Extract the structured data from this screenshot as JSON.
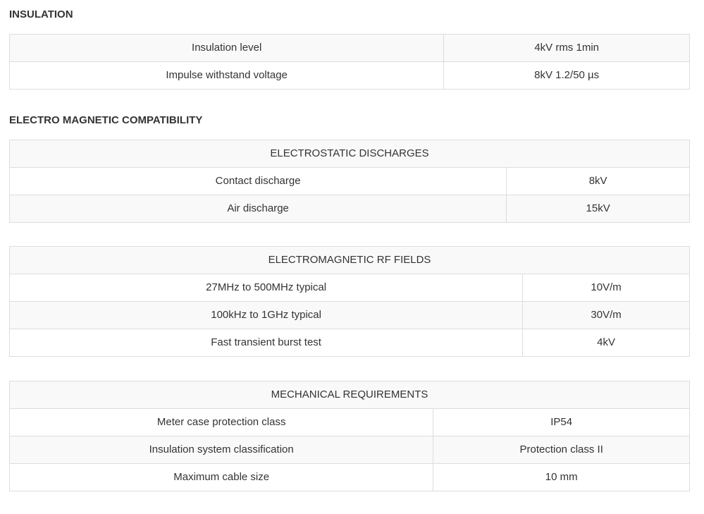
{
  "insulation": {
    "title": "INSULATION",
    "rows": [
      {
        "label": "Insulation level",
        "value": "4kV rms 1min"
      },
      {
        "label": "Impulse withstand voltage",
        "value": "8kV 1.2/50 µs"
      }
    ]
  },
  "emc": {
    "title": "ELECTRO MAGNETIC COMPATIBILITY",
    "electrostatic": {
      "header": "ELECTROSTATIC DISCHARGES",
      "rows": [
        {
          "label": "Contact discharge",
          "value": "8kV"
        },
        {
          "label": "Air discharge",
          "value": "15kV"
        }
      ]
    },
    "rf_fields": {
      "header": "ELECTROMAGNETIC RF FIELDS",
      "rows": [
        {
          "label": "27MHz to 500MHz typical",
          "value": "10V/m"
        },
        {
          "label": "100kHz to 1GHz typical",
          "value": "30V/m"
        },
        {
          "label": "Fast transient burst test",
          "value": "4kV"
        }
      ]
    }
  },
  "mechanical": {
    "header": "MECHANICAL REQUIREMENTS",
    "rows": [
      {
        "label": "Meter case protection class",
        "value": "IP54"
      },
      {
        "label": "Insulation system classification",
        "value": "Protection class II"
      },
      {
        "label": "Maximum cable size",
        "value": "10 mm"
      }
    ]
  }
}
